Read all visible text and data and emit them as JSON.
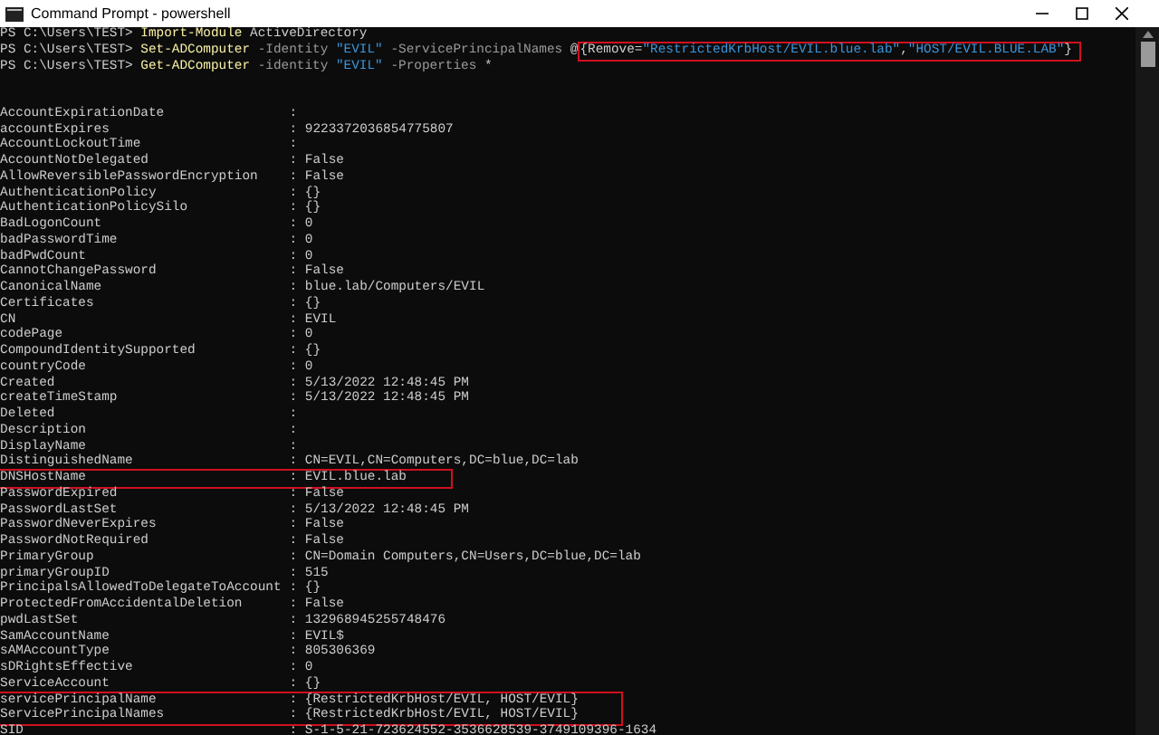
{
  "window": {
    "title": "Command Prompt - powershell"
  },
  "commands": [
    {
      "prompt": "PS C:\\Users\\TEST>",
      "tokens": [
        {
          "text": "Import-Module",
          "kind": "cmdlet",
          "boxed": false
        },
        {
          "text": "ActiveDirectory",
          "kind": "plain",
          "boxed": false
        }
      ]
    },
    {
      "prompt": "PS C:\\Users\\TEST>",
      "tokens": [
        {
          "text": "Set-ADComputer",
          "kind": "cmdlet",
          "boxed": false
        },
        {
          "text": "-Identity",
          "kind": "param",
          "boxed": false
        },
        {
          "text": "\"EVIL\"",
          "kind": "string",
          "boxed": false
        },
        {
          "text": "-ServicePrincipalNames",
          "kind": "param",
          "boxed": false
        },
        {
          "text": "@",
          "kind": "plain",
          "boxed": false
        },
        {
          "text": "{Remove=",
          "kind": "plain",
          "boxed": true
        },
        {
          "text": "\"RestrictedKrbHost/EVIL.blue.lab\"",
          "kind": "string",
          "boxed": true
        },
        {
          "text": ",",
          "kind": "plain",
          "boxed": true
        },
        {
          "text": "\"HOST/EVIL.BLUE.LAB\"",
          "kind": "string",
          "boxed": true
        },
        {
          "text": "}",
          "kind": "plain",
          "boxed": true
        }
      ]
    },
    {
      "prompt": "PS C:\\Users\\TEST>",
      "tokens": [
        {
          "text": "Get-ADComputer",
          "kind": "cmdlet",
          "boxed": false
        },
        {
          "text": "-identity",
          "kind": "param",
          "boxed": false
        },
        {
          "text": "\"EVIL\"",
          "kind": "string",
          "boxed": false
        },
        {
          "text": "-Properties",
          "kind": "param",
          "boxed": false
        },
        {
          "text": "*",
          "kind": "plain",
          "boxed": false
        }
      ]
    }
  ],
  "properties": [
    {
      "name": "AccountExpirationDate",
      "value": ":",
      "highlighted": false
    },
    {
      "name": "accountExpires",
      "value": ": 9223372036854775807",
      "highlighted": false
    },
    {
      "name": "AccountLockoutTime",
      "value": ":",
      "highlighted": false
    },
    {
      "name": "AccountNotDelegated",
      "value": ": False",
      "highlighted": false
    },
    {
      "name": "AllowReversiblePasswordEncryption",
      "value": ": False",
      "highlighted": false
    },
    {
      "name": "AuthenticationPolicy",
      "value": ": {}",
      "highlighted": false
    },
    {
      "name": "AuthenticationPolicySilo",
      "value": ": {}",
      "highlighted": false
    },
    {
      "name": "BadLogonCount",
      "value": ": 0",
      "highlighted": false
    },
    {
      "name": "badPasswordTime",
      "value": ": 0",
      "highlighted": false
    },
    {
      "name": "badPwdCount",
      "value": ": 0",
      "highlighted": false
    },
    {
      "name": "CannotChangePassword",
      "value": ": False",
      "highlighted": false
    },
    {
      "name": "CanonicalName",
      "value": ": blue.lab/Computers/EVIL",
      "highlighted": false
    },
    {
      "name": "Certificates",
      "value": ": {}",
      "highlighted": false
    },
    {
      "name": "CN",
      "value": ": EVIL",
      "highlighted": false
    },
    {
      "name": "codePage",
      "value": ": 0",
      "highlighted": false
    },
    {
      "name": "CompoundIdentitySupported",
      "value": ": {}",
      "highlighted": false
    },
    {
      "name": "countryCode",
      "value": ": 0",
      "highlighted": false
    },
    {
      "name": "Created",
      "value": ": 5/13/2022 12:48:45 PM",
      "highlighted": false
    },
    {
      "name": "createTimeStamp",
      "value": ": 5/13/2022 12:48:45 PM",
      "highlighted": false
    },
    {
      "name": "Deleted",
      "value": ":",
      "highlighted": false
    },
    {
      "name": "Description",
      "value": ":",
      "highlighted": false
    },
    {
      "name": "DisplayName",
      "value": ":",
      "highlighted": false
    },
    {
      "name": "DistinguishedName",
      "value": ": CN=EVIL,CN=Computers,DC=blue,DC=lab",
      "highlighted": false
    },
    {
      "name": "DNSHostName",
      "value": ": EVIL.blue.lab",
      "highlighted": true
    },
    {
      "name": "PasswordExpired",
      "value": ": False",
      "highlighted": false
    },
    {
      "name": "PasswordLastSet",
      "value": ": 5/13/2022 12:48:45 PM",
      "highlighted": false
    },
    {
      "name": "PasswordNeverExpires",
      "value": ": False",
      "highlighted": false
    },
    {
      "name": "PasswordNotRequired",
      "value": ": False",
      "highlighted": false
    },
    {
      "name": "PrimaryGroup",
      "value": ": CN=Domain Computers,CN=Users,DC=blue,DC=lab",
      "highlighted": false
    },
    {
      "name": "primaryGroupID",
      "value": ": 515",
      "highlighted": false
    },
    {
      "name": "PrincipalsAllowedToDelegateToAccount",
      "value": ": {}",
      "highlighted": false
    },
    {
      "name": "ProtectedFromAccidentalDeletion",
      "value": ": False",
      "highlighted": false
    },
    {
      "name": "pwdLastSet",
      "value": ": 132968945255748476",
      "highlighted": false
    },
    {
      "name": "SamAccountName",
      "value": ": EVIL$",
      "highlighted": false
    },
    {
      "name": "sAMAccountType",
      "value": ": 805306369",
      "highlighted": false
    },
    {
      "name": "sDRightsEffective",
      "value": ": 0",
      "highlighted": false
    },
    {
      "name": "ServiceAccount",
      "value": ": {}",
      "highlighted": false
    },
    {
      "name": "servicePrincipalName",
      "value": ": {RestrictedKrbHost/EVIL, HOST/EVIL}",
      "highlighted": true
    },
    {
      "name": "ServicePrincipalNames",
      "value": ": {RestrictedKrbHost/EVIL, HOST/EVIL}",
      "highlighted": true
    },
    {
      "name": "SID",
      "value": ": S-1-5-21-723624552-3536628539-3749109396-1634",
      "highlighted": false
    }
  ]
}
